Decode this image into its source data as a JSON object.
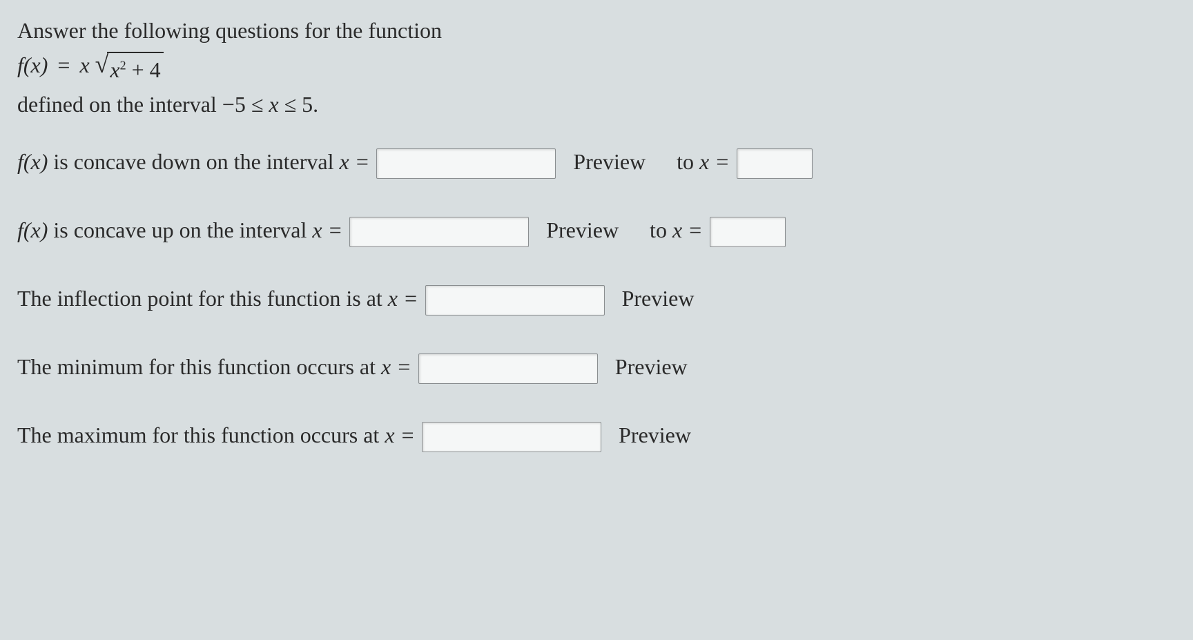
{
  "intro": {
    "line1": "Answer the following questions for the function",
    "fx_label": "f(x)",
    "equals": "=",
    "x_coef": "x",
    "sqrt_inner_var": "x",
    "sqrt_inner_exp": "2",
    "plus_const": "+ 4",
    "line3_prefix": "defined on the interval ",
    "interval_low": "−5",
    "leq1": "≤",
    "interval_var": "x",
    "leq2": "≤",
    "interval_high": "5",
    "period": "."
  },
  "rows": {
    "concave_down": {
      "prefix_fx": "f(x)",
      "prefix_text": " is concave down on the interval ",
      "x_eq": "x =",
      "preview": "Preview",
      "to_text": "to ",
      "to_x_eq": "x ="
    },
    "concave_up": {
      "prefix_fx": "f(x)",
      "prefix_text": " is concave up on the interval ",
      "x_eq": "x =",
      "preview": "Preview",
      "to_text": "to ",
      "to_x_eq": "x ="
    },
    "inflection": {
      "text": "The inflection point for this function is at ",
      "x_eq": "x =",
      "preview": "Preview"
    },
    "minimum": {
      "text": "The minimum for this function occurs at ",
      "x_eq": "x =",
      "preview": "Preview"
    },
    "maximum": {
      "text": "The maximum for this function occurs at ",
      "x_eq": "x =",
      "preview": "Preview"
    }
  }
}
